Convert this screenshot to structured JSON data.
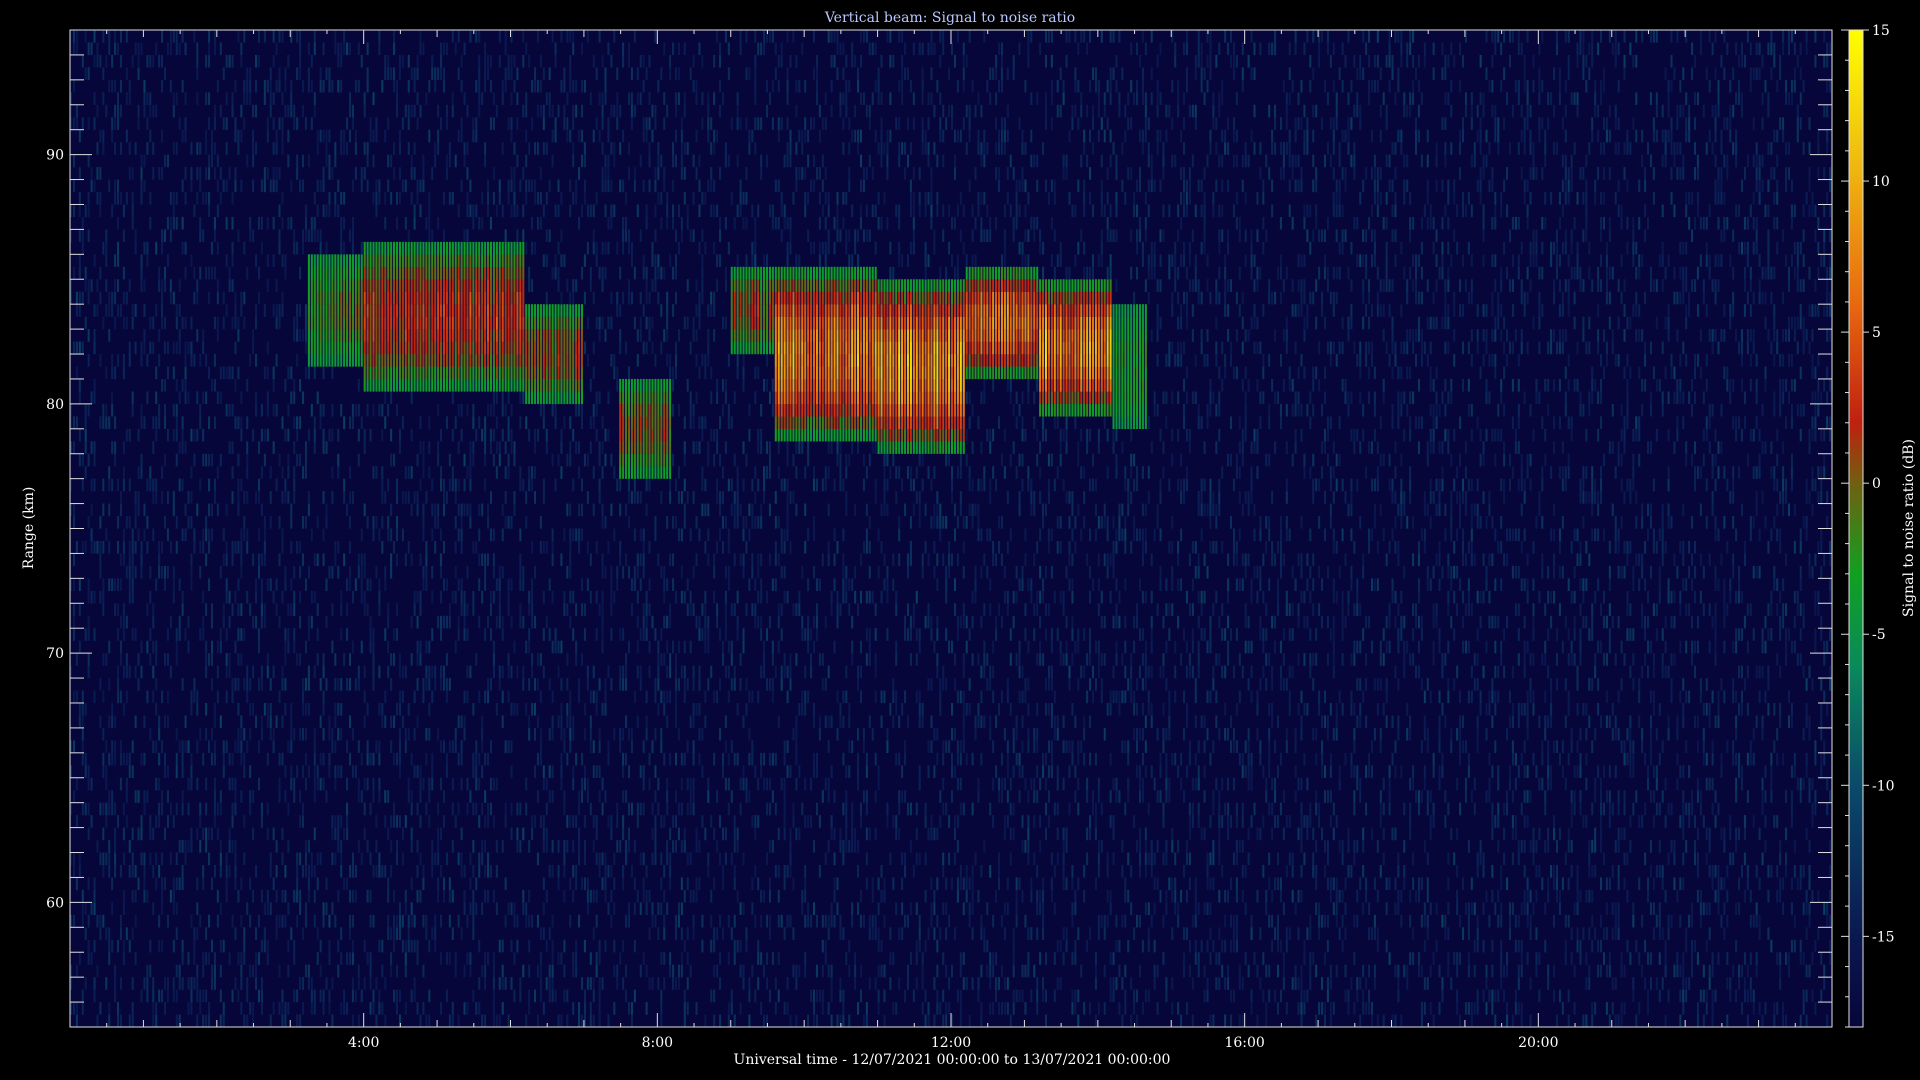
{
  "chart_data": {
    "type": "heatmap",
    "title": "Vertical beam: Signal to noise ratio",
    "xlabel": "Universal time - 12/07/2021 00:00:00 to 13/07/2021 00:00:00",
    "ylabel": "Range (km)",
    "colorbar_label": "Signal to noise ratio (dB)",
    "xlim_hours": [
      0,
      24
    ],
    "ylim_km": [
      55,
      95
    ],
    "clim_db": [
      -18,
      15
    ],
    "x_ticks": [
      {
        "hour": 4,
        "label": "4:00"
      },
      {
        "hour": 8,
        "label": "8:00"
      },
      {
        "hour": 12,
        "label": "12:00"
      },
      {
        "hour": 16,
        "label": "16:00"
      },
      {
        "hour": 20,
        "label": "20:00"
      }
    ],
    "y_ticks": [
      {
        "km": 60,
        "label": "60"
      },
      {
        "km": 70,
        "label": "70"
      },
      {
        "km": 80,
        "label": "80"
      },
      {
        "km": 90,
        "label": "90"
      }
    ],
    "colorbar_ticks": [
      {
        "db": 15,
        "label": "15"
      },
      {
        "db": 10,
        "label": "10"
      },
      {
        "db": 5,
        "label": "5"
      },
      {
        "db": 0,
        "label": "0"
      },
      {
        "db": -5,
        "label": "-5"
      },
      {
        "db": -10,
        "label": "-10"
      },
      {
        "db": -15,
        "label": "-15"
      }
    ],
    "colormap": [
      {
        "db": -18,
        "color": "#06063a"
      },
      {
        "db": -15,
        "color": "#0a1850"
      },
      {
        "db": -10,
        "color": "#0a4a6a"
      },
      {
        "db": -6,
        "color": "#0a8a5a"
      },
      {
        "db": -3,
        "color": "#10a020"
      },
      {
        "db": 0,
        "color": "#706010"
      },
      {
        "db": 2,
        "color": "#c02010"
      },
      {
        "db": 6,
        "color": "#e86a10"
      },
      {
        "db": 11,
        "color": "#f0c010"
      },
      {
        "db": 15,
        "color": "#ffff00"
      }
    ],
    "echo_regions": [
      {
        "t_start": 3.25,
        "t_end": 4.0,
        "r_min": 81.5,
        "r_max": 86.0,
        "peak_db": 0
      },
      {
        "t_start": 4.0,
        "t_end": 6.2,
        "r_min": 80.5,
        "r_max": 86.5,
        "peak_db": 5
      },
      {
        "t_start": 6.2,
        "t_end": 7.0,
        "r_min": 80.0,
        "r_max": 84.0,
        "peak_db": 3
      },
      {
        "t_start": 7.5,
        "t_end": 8.2,
        "r_min": 77.0,
        "r_max": 81.0,
        "peak_db": 2
      },
      {
        "t_start": 9.0,
        "t_end": 9.6,
        "r_min": 82.0,
        "r_max": 85.5,
        "peak_db": 3
      },
      {
        "t_start": 9.6,
        "t_end": 11.0,
        "r_min": 78.5,
        "r_max": 85.5,
        "peak_db": 12
      },
      {
        "t_start": 11.0,
        "t_end": 12.2,
        "r_min": 78.0,
        "r_max": 85.0,
        "peak_db": 13
      },
      {
        "t_start": 12.2,
        "t_end": 13.2,
        "r_min": 81.0,
        "r_max": 85.5,
        "peak_db": 10
      },
      {
        "t_start": 13.2,
        "t_end": 14.2,
        "r_min": 79.5,
        "r_max": 85.0,
        "peak_db": 13
      },
      {
        "t_start": 14.2,
        "t_end": 14.7,
        "r_min": 79.0,
        "r_max": 84.0,
        "peak_db": -2
      }
    ]
  }
}
